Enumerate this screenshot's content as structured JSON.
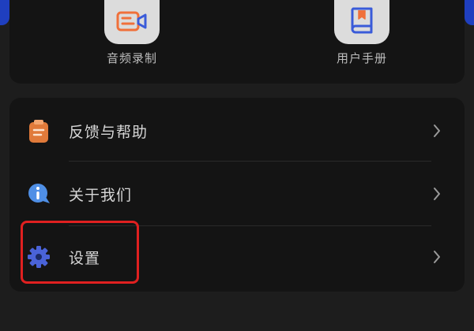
{
  "shortcuts": [
    {
      "label": "音频录制",
      "icon": "video-record-icon"
    },
    {
      "label": "用户手册",
      "icon": "manual-book-icon"
    }
  ],
  "menu": {
    "items": [
      {
        "label": "反馈与帮助",
        "icon": "feedback-clipboard-icon"
      },
      {
        "label": "关于我们",
        "icon": "info-icon"
      },
      {
        "label": "设置",
        "icon": "settings-gear-icon"
      }
    ],
    "chevron_icon": "chevron-right-icon"
  },
  "colors": {
    "background": "#1d1d1d",
    "card": "#141414",
    "text": "#d6d6d6",
    "accent_blue": "#1f3fbf",
    "highlight_red": "#e02020",
    "feedback_orange": "#e07a3a",
    "gear_blue": "#4a63d8"
  }
}
